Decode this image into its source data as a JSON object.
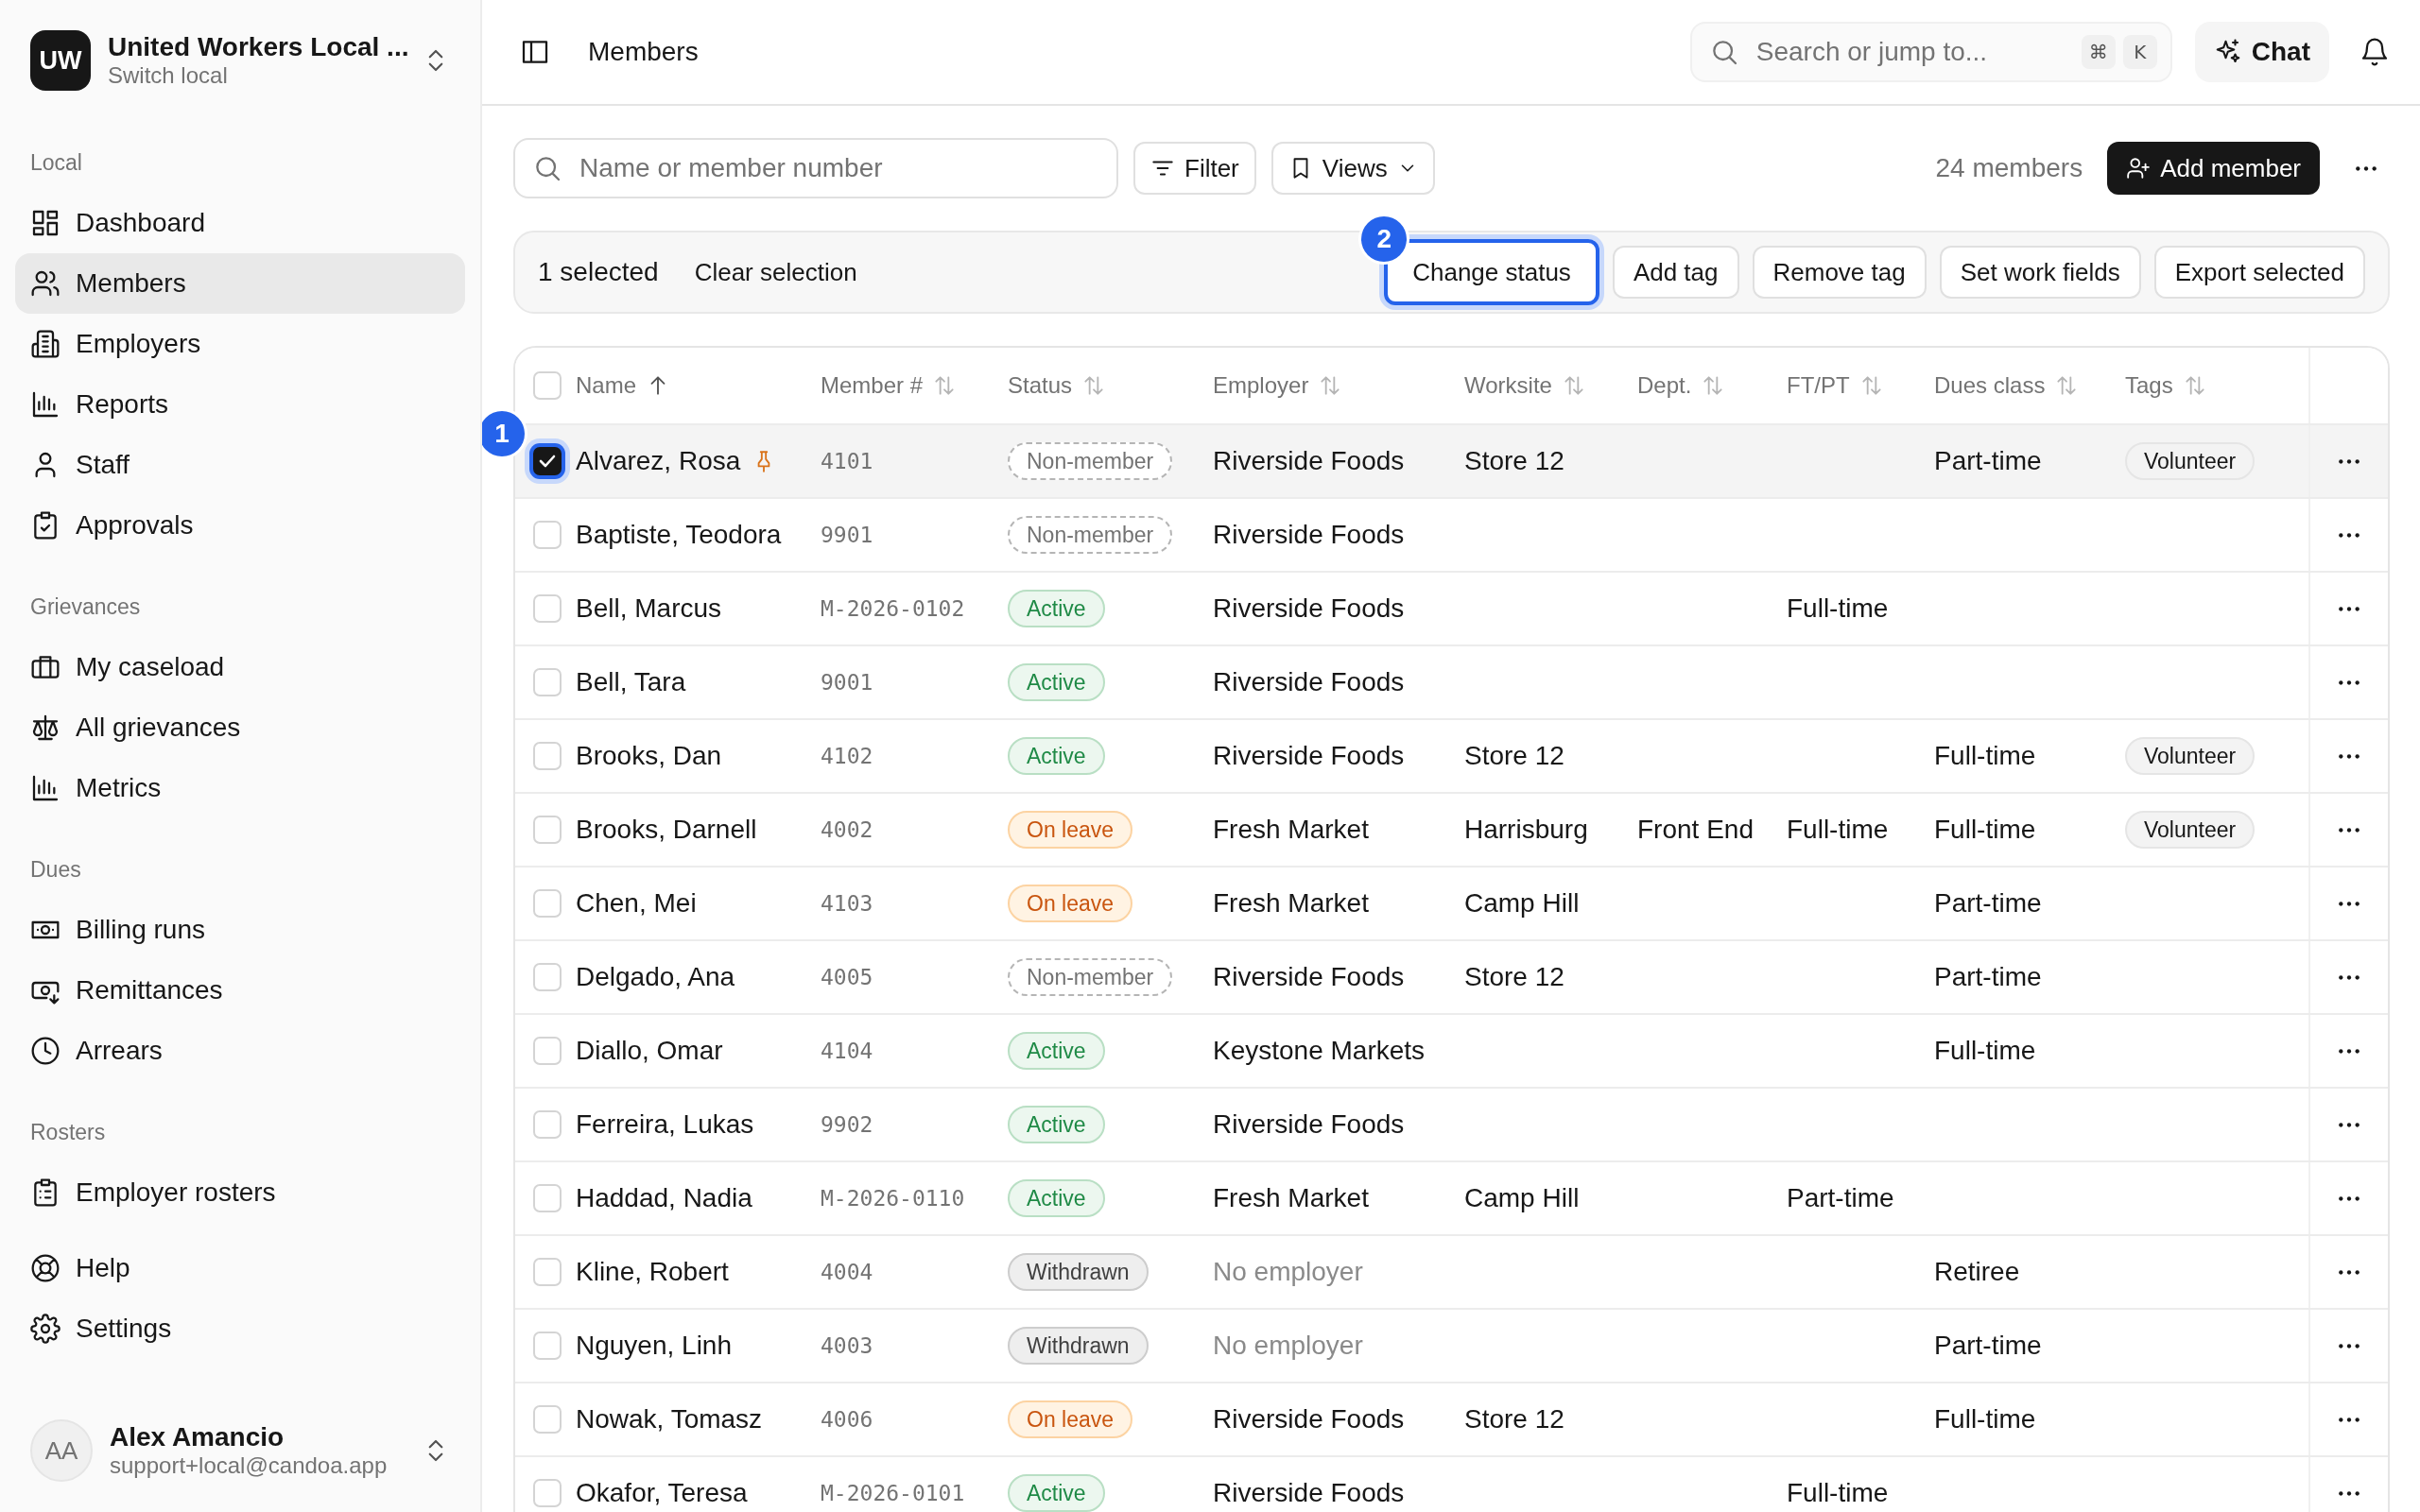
{
  "sidebar": {
    "org": {
      "initials": "UW",
      "name": "United Workers Local ...",
      "subtitle": "Switch local"
    },
    "sections": [
      {
        "label": "Local",
        "items": [
          {
            "label": "Dashboard",
            "selected": false
          },
          {
            "label": "Members",
            "selected": true
          },
          {
            "label": "Employers",
            "selected": false
          },
          {
            "label": "Reports",
            "selected": false
          },
          {
            "label": "Staff",
            "selected": false
          },
          {
            "label": "Approvals",
            "selected": false
          }
        ]
      },
      {
        "label": "Grievances",
        "items": [
          {
            "label": "My caseload",
            "selected": false
          },
          {
            "label": "All grievances",
            "selected": false
          },
          {
            "label": "Metrics",
            "selected": false
          }
        ]
      },
      {
        "label": "Dues",
        "items": [
          {
            "label": "Billing runs",
            "selected": false
          },
          {
            "label": "Remittances",
            "selected": false
          },
          {
            "label": "Arrears",
            "selected": false
          }
        ]
      },
      {
        "label": "Rosters",
        "items": [
          {
            "label": "Employer rosters",
            "selected": false
          }
        ]
      }
    ],
    "footer_items": [
      {
        "label": "Help",
        "selected": false
      },
      {
        "label": "Settings",
        "selected": false
      }
    ],
    "user": {
      "initials": "AA",
      "name": "Alex Amancio",
      "email": "support+local@candoa.app"
    }
  },
  "header": {
    "title": "Members",
    "search": {
      "placeholder": "Search or jump to...",
      "keys": [
        "⌘",
        "K"
      ]
    },
    "chat_button": "Chat"
  },
  "toolbar": {
    "search": {
      "placeholder": "Name or member number"
    },
    "filter_button": "Filter",
    "views_button": "Views",
    "count": "24 members",
    "add_button": "Add member"
  },
  "selection_bar": {
    "count": "1 selected",
    "clear": "Clear selection",
    "actions": [
      {
        "label": "Change status",
        "marker": "2"
      },
      {
        "label": "Add tag"
      },
      {
        "label": "Remove tag"
      },
      {
        "label": "Set work fields"
      },
      {
        "label": "Export selected"
      }
    ]
  },
  "table": {
    "select_all": {
      "checked": false
    },
    "columns": [
      {
        "label": "Name",
        "sorted": true
      },
      {
        "label": "Member #",
        "sorted": false
      },
      {
        "label": "Status",
        "sorted": false
      },
      {
        "label": "Employer",
        "sorted": false
      },
      {
        "label": "Worksite",
        "sorted": false
      },
      {
        "label": "Dept.",
        "sorted": false
      },
      {
        "label": "FT/PT",
        "sorted": false
      },
      {
        "label": "Dues class",
        "sorted": false
      },
      {
        "label": "Tags",
        "sorted": false
      }
    ],
    "rows": [
      {
        "name": "Alvarez, Rosa",
        "pinned": true,
        "checked": true,
        "marker": "1",
        "member_no": "4101",
        "status": {
          "label": "Non-member",
          "kind": "nonmember"
        },
        "employer": "Riverside Foods",
        "employer_muted": false,
        "worksite": "Store 12",
        "dues_class": "Part-time",
        "tags": [
          "Volunteer"
        ]
      },
      {
        "name": "Baptiste, Teodora",
        "pinned": false,
        "checked": false,
        "member_no": "9901",
        "status": {
          "label": "Non-member",
          "kind": "nonmember"
        },
        "employer": "Riverside Foods",
        "employer_muted": false
      },
      {
        "name": "Bell, Marcus",
        "pinned": false,
        "checked": false,
        "member_no": "M-2026-0102",
        "status": {
          "label": "Active",
          "kind": "active"
        },
        "employer": "Riverside Foods",
        "employer_muted": false,
        "ft_pt": "Full-time"
      },
      {
        "name": "Bell, Tara",
        "pinned": false,
        "checked": false,
        "member_no": "9001",
        "status": {
          "label": "Active",
          "kind": "active"
        },
        "employer": "Riverside Foods",
        "employer_muted": false
      },
      {
        "name": "Brooks, Dan",
        "pinned": false,
        "checked": false,
        "member_no": "4102",
        "status": {
          "label": "Active",
          "kind": "active"
        },
        "employer": "Riverside Foods",
        "employer_muted": false,
        "worksite": "Store 12",
        "dues_class": "Full-time",
        "tags": [
          "Volunteer"
        ]
      },
      {
        "name": "Brooks, Darnell",
        "pinned": false,
        "checked": false,
        "member_no": "4002",
        "status": {
          "label": "On leave",
          "kind": "leave"
        },
        "employer": "Fresh Market",
        "employer_muted": false,
        "worksite": "Harrisburg",
        "dept": "Front End",
        "ft_pt": "Full-time",
        "dues_class": "Full-time",
        "tags": [
          "Volunteer"
        ]
      },
      {
        "name": "Chen, Mei",
        "pinned": false,
        "checked": false,
        "member_no": "4103",
        "status": {
          "label": "On leave",
          "kind": "leave"
        },
        "employer": "Fresh Market",
        "employer_muted": false,
        "worksite": "Camp Hill",
        "dues_class": "Part-time"
      },
      {
        "name": "Delgado, Ana",
        "pinned": false,
        "checked": false,
        "member_no": "4005",
        "status": {
          "label": "Non-member",
          "kind": "nonmember"
        },
        "employer": "Riverside Foods",
        "employer_muted": false,
        "worksite": "Store 12",
        "dues_class": "Part-time"
      },
      {
        "name": "Diallo, Omar",
        "pinned": false,
        "checked": false,
        "member_no": "4104",
        "status": {
          "label": "Active",
          "kind": "active"
        },
        "employer": "Keystone Markets",
        "employer_muted": false,
        "dues_class": "Full-time"
      },
      {
        "name": "Ferreira, Lukas",
        "pinned": false,
        "checked": false,
        "member_no": "9902",
        "status": {
          "label": "Active",
          "kind": "active"
        },
        "employer": "Riverside Foods",
        "employer_muted": false
      },
      {
        "name": "Haddad, Nadia",
        "pinned": false,
        "checked": false,
        "member_no": "M-2026-0110",
        "status": {
          "label": "Active",
          "kind": "active"
        },
        "employer": "Fresh Market",
        "employer_muted": false,
        "worksite": "Camp Hill",
        "ft_pt": "Part-time"
      },
      {
        "name": "Kline, Robert",
        "pinned": false,
        "checked": false,
        "member_no": "4004",
        "status": {
          "label": "Withdrawn",
          "kind": "withdrawn"
        },
        "employer": "No employer",
        "employer_muted": true,
        "dues_class": "Retiree"
      },
      {
        "name": "Nguyen, Linh",
        "pinned": false,
        "checked": false,
        "member_no": "4003",
        "status": {
          "label": "Withdrawn",
          "kind": "withdrawn"
        },
        "employer": "No employer",
        "employer_muted": true,
        "dues_class": "Part-time"
      },
      {
        "name": "Nowak, Tomasz",
        "pinned": false,
        "checked": false,
        "member_no": "4006",
        "status": {
          "label": "On leave",
          "kind": "leave"
        },
        "employer": "Riverside Foods",
        "employer_muted": false,
        "worksite": "Store 12",
        "dues_class": "Full-time"
      },
      {
        "name": "Okafor, Teresa",
        "pinned": false,
        "checked": false,
        "member_no": "M-2026-0101",
        "status": {
          "label": "Active",
          "kind": "active"
        },
        "employer": "Riverside Foods",
        "employer_muted": false,
        "ft_pt": "Full-time"
      }
    ]
  }
}
